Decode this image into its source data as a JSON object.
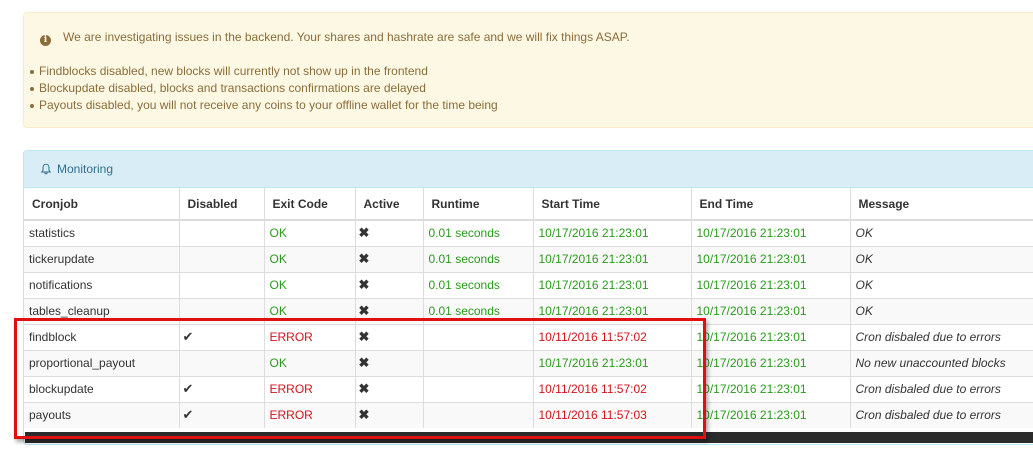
{
  "alert": {
    "headline": "We are investigating issues in the backend. Your shares and hashrate are safe and we will fix things ASAP.",
    "items": [
      "Findblocks disabled, new blocks will currently not show up in the frontend",
      "Blockupdate disabled, blocks and transactions confirmations are delayed",
      "Payouts disabled, you will not receive any coins to your offline wallet for the time being"
    ]
  },
  "panel": {
    "title": "Monitoring"
  },
  "columns": [
    "Cronjob",
    "Disabled",
    "Exit Code",
    "Active",
    "Runtime",
    "Start Time",
    "End Time",
    "Message"
  ],
  "rows": [
    {
      "cronjob": "statistics",
      "disabled": "",
      "exit_code": "OK",
      "active": "✖",
      "runtime": "0.01 seconds",
      "start_time": "10/17/2016 21:23:01",
      "end_time": "10/17/2016 21:23:01",
      "message": "OK"
    },
    {
      "cronjob": "tickerupdate",
      "disabled": "",
      "exit_code": "OK",
      "active": "✖",
      "runtime": "0.01 seconds",
      "start_time": "10/17/2016 21:23:01",
      "end_time": "10/17/2016 21:23:01",
      "message": "OK"
    },
    {
      "cronjob": "notifications",
      "disabled": "",
      "exit_code": "OK",
      "active": "✖",
      "runtime": "0.01 seconds",
      "start_time": "10/17/2016 21:23:01",
      "end_time": "10/17/2016 21:23:01",
      "message": "OK"
    },
    {
      "cronjob": "tables_cleanup",
      "disabled": "",
      "exit_code": "OK",
      "active": "✖",
      "runtime": "0.01 seconds",
      "start_time": "10/17/2016 21:23:01",
      "end_time": "10/17/2016 21:23:01",
      "message": "OK"
    },
    {
      "cronjob": "findblock",
      "disabled": "✔",
      "exit_code": "ERROR",
      "active": "✖",
      "runtime": "",
      "start_time": "10/11/2016 11:57:02",
      "end_time": "10/17/2016 21:23:01",
      "message": "Cron disbaled due to errors"
    },
    {
      "cronjob": "proportional_payout",
      "disabled": "",
      "exit_code": "OK",
      "active": "✖",
      "runtime": "",
      "start_time": "10/17/2016 21:23:01",
      "end_time": "10/17/2016 21:23:01",
      "message": "No new unaccounted blocks"
    },
    {
      "cronjob": "blockupdate",
      "disabled": "✔",
      "exit_code": "ERROR",
      "active": "✖",
      "runtime": "",
      "start_time": "10/11/2016 11:57:02",
      "end_time": "10/17/2016 21:23:01",
      "message": "Cron disbaled due to errors"
    },
    {
      "cronjob": "payouts",
      "disabled": "✔",
      "exit_code": "ERROR",
      "active": "✖",
      "runtime": "",
      "start_time": "10/11/2016 11:57:03",
      "end_time": "10/17/2016 21:23:01",
      "message": "Cron disbaled due to errors"
    }
  ],
  "colors": {
    "ok": "#2a9a1d",
    "error": "#d0141c",
    "highlight": "#e01010"
  },
  "icons": {
    "alert": "info-circle-icon",
    "panel": "bell-icon",
    "disabled": "check-icon",
    "active": "x-icon"
  }
}
